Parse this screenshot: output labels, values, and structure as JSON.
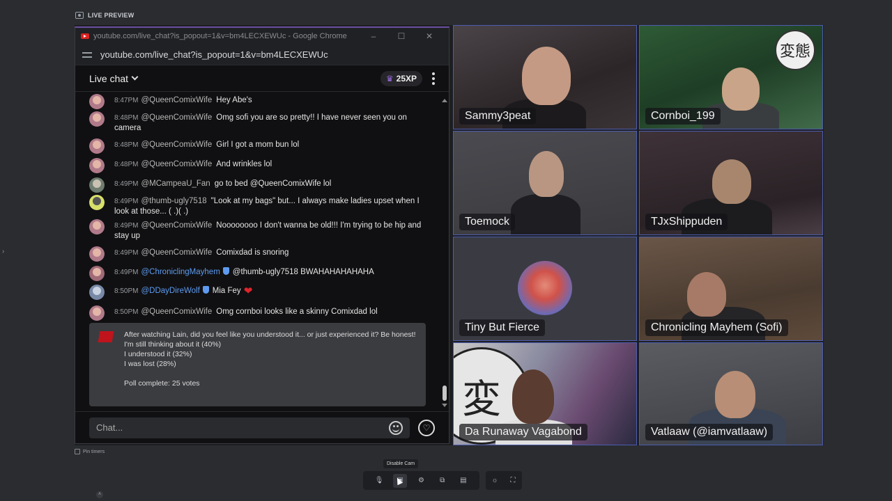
{
  "preview_label": "LIVE PREVIEW",
  "chrome": {
    "window_title": "youtube.com/live_chat?is_popout=1&v=bm4LECXEWUc - Google Chrome",
    "url": "youtube.com/live_chat?is_popout=1&v=bm4LECXEWUc",
    "minimize": "–",
    "maximize": "☐",
    "close": "✕"
  },
  "chat": {
    "title": "Live chat",
    "xp": "25XP",
    "messages": [
      {
        "time": "8:47PM",
        "author": "@QueenComixWife",
        "text": "Hey Abe's"
      },
      {
        "time": "8:48PM",
        "author": "@QueenComixWife",
        "text": "Omg sofi you are so pretty!! I have never seen you on camera"
      },
      {
        "time": "8:48PM",
        "author": "@QueenComixWife",
        "text": "Girl I got a mom bun lol"
      },
      {
        "time": "8:48PM",
        "author": "@QueenComixWife",
        "text": "And wrinkles lol"
      },
      {
        "time": "8:49PM",
        "author": "@MCampeaU_Fan",
        "text": "go to bed @QueenComixWife lol"
      },
      {
        "time": "8:49PM",
        "author": "@thumb-ugly7518",
        "text": "\"Look at my bags\" but... I always make ladies upset when I look at those... ( .)( .)"
      },
      {
        "time": "8:49PM",
        "author": "@QueenComixWife",
        "text": "Noooooooo I don't wanna be old!!! I'm trying to be hip and stay up"
      },
      {
        "time": "8:49PM",
        "author": "@QueenComixWife",
        "text": "Comixdad is snoring"
      },
      {
        "time": "8:49PM",
        "author": "@ChroniclingMayhem",
        "text": "@thumb-ugly7518 BWAHAHAHAHAHA"
      },
      {
        "time": "8:50PM",
        "author": "@DDayDireWolf",
        "text": "Mia Fey"
      },
      {
        "time": "8:50PM",
        "author": "@QueenComixWife",
        "text": "Omg cornboi looks like a skinny Comixdad lol"
      }
    ],
    "poll": {
      "question": "After watching Lain, did you feel like you understood it... or just experienced it? Be honest!",
      "options": [
        "I'm still thinking about it (40%)",
        "I understood it (32%)",
        "I was lost (28%)"
      ],
      "footer": "Poll complete: 25 votes"
    },
    "input_placeholder": "Chat..."
  },
  "participants": [
    "Sammy3peat",
    "Cornboi_199",
    "Toemock",
    "TJxShippuden",
    "Tiny But Fierce",
    "Chronicling Mayhem (Sofi)",
    "Da Runaway Vagabond",
    "Vatlaaw (@iamvatlaaw)"
  ],
  "footer": {
    "pin_label": "Pin timers",
    "tooltip": "Disable Cam"
  },
  "colors": {
    "accent": "#4d5db0",
    "chrome_border_top": "#6a4fa0",
    "heart": "#e0242b",
    "mention_blue": "#5e9bf0"
  }
}
